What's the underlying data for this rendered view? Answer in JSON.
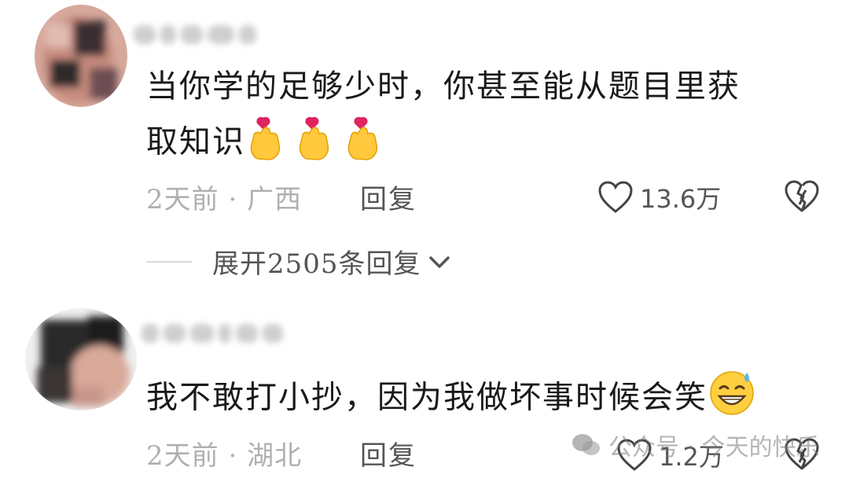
{
  "comments": [
    {
      "text": "当你学的足够少时，你甚至能从题目里获",
      "text_line2": "取知识",
      "emoji": "finger-heart-emoji",
      "time": "2天前",
      "separator": "·",
      "location": "广西",
      "reply_label": "回复",
      "likes": "13.6万"
    },
    {
      "text": "我不敢打小抄，因为我做坏事时候会笑",
      "emoji": "grinning-sweat-emoji",
      "time": "2天前",
      "separator": "·",
      "location": "湖北",
      "reply_label": "回复",
      "likes": "1.2万"
    }
  ],
  "expand": {
    "label": "展开2505条回复"
  },
  "watermark": {
    "text": "公众号 · 今天的快乐"
  },
  "colors": {
    "text": "#1a1a1a",
    "meta": "#b0b0b0",
    "action": "#555555"
  }
}
